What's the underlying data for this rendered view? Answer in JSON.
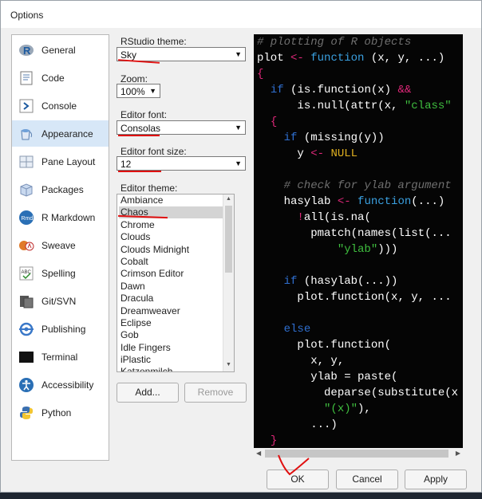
{
  "window": {
    "title": "Options"
  },
  "sidebar": {
    "items": [
      {
        "label": "General",
        "icon": "r-logo-icon"
      },
      {
        "label": "Code",
        "icon": "code-page-icon"
      },
      {
        "label": "Console",
        "icon": "console-prompt-icon"
      },
      {
        "label": "Appearance",
        "icon": "paint-bucket-icon",
        "active": true
      },
      {
        "label": "Pane Layout",
        "icon": "pane-layout-icon"
      },
      {
        "label": "Packages",
        "icon": "package-box-icon"
      },
      {
        "label": "R Markdown",
        "icon": "rmd-icon"
      },
      {
        "label": "Sweave",
        "icon": "sweave-pdf-icon"
      },
      {
        "label": "Spelling",
        "icon": "spelling-abc-icon"
      },
      {
        "label": "Git/SVN",
        "icon": "git-svn-icon"
      },
      {
        "label": "Publishing",
        "icon": "publishing-icon"
      },
      {
        "label": "Terminal",
        "icon": "terminal-icon"
      },
      {
        "label": "Accessibility",
        "icon": "accessibility-icon"
      },
      {
        "label": "Python",
        "icon": "python-logo-icon"
      }
    ]
  },
  "appearance": {
    "rstudio_theme_label": "RStudio theme:",
    "rstudio_theme_value": "Sky",
    "zoom_label": "Zoom:",
    "zoom_value": "100%",
    "editor_font_label": "Editor font:",
    "editor_font_value": "Consolas",
    "editor_font_size_label": "Editor font size:",
    "editor_font_size_value": "12",
    "editor_theme_label": "Editor theme:",
    "editor_themes": [
      "Ambiance",
      "Chaos",
      "Chrome",
      "Clouds",
      "Clouds Midnight",
      "Cobalt",
      "Crimson Editor",
      "Dawn",
      "Dracula",
      "Dreamweaver",
      "Eclipse",
      "Gob",
      "Idle Fingers",
      "iPlastic",
      "Katzenmilch"
    ],
    "selected_theme": "Chaos",
    "add_label": "Add...",
    "remove_label": "Remove"
  },
  "preview": {
    "lines": [
      "# plotting of R objects",
      "plot <- function (x, y, ...)",
      "{",
      "  if (is.function(x) &&",
      "      is.null(attr(x, \"class\"",
      "  {",
      "    if (missing(y))",
      "      y <- NULL",
      "",
      "    # check for ylab argument",
      "    hasylab <- function(...)",
      "      !all(is.na(",
      "        pmatch(names(list(...",
      "            \"ylab\")))",
      "",
      "    if (hasylab(...))",
      "      plot.function(x, y, ...",
      "",
      "    else",
      "      plot.function(",
      "        x, y,",
      "        ylab = paste(",
      "          deparse(substitute(x",
      "          \"(x)\"),",
      "        ...)",
      "  }"
    ],
    "colors": {
      "background": "#050505",
      "comment": "#6f6f6f",
      "keyword": "#2f6fd0",
      "function": "#3aa0e0",
      "string": "#3fbf3f",
      "operator": "#e0287a",
      "brace": "#e0287a",
      "text": "#ffffff",
      "constant": "#e0b020"
    }
  },
  "footer": {
    "ok_label": "OK",
    "cancel_label": "Cancel",
    "apply_label": "Apply"
  },
  "annotation_color": "#e01010"
}
